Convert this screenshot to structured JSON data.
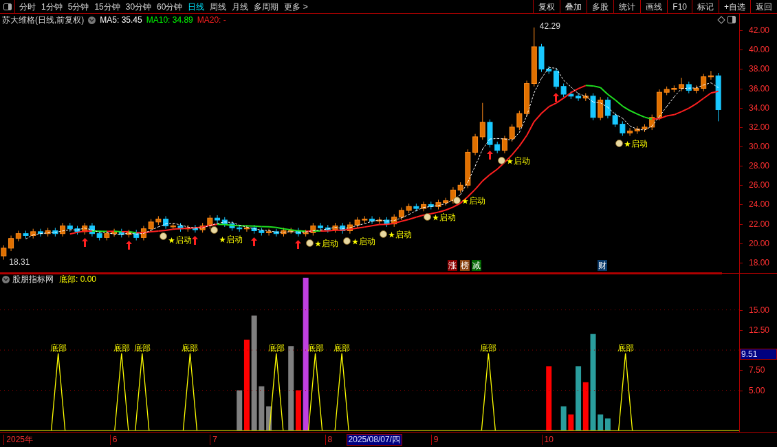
{
  "toolbar": {
    "tabs": [
      {
        "label": "分时",
        "selected": false
      },
      {
        "label": "1分钟",
        "selected": false
      },
      {
        "label": "5分钟",
        "selected": false
      },
      {
        "label": "15分钟",
        "selected": false
      },
      {
        "label": "30分钟",
        "selected": false
      },
      {
        "label": "60分钟",
        "selected": false
      },
      {
        "label": "日线",
        "selected": true
      },
      {
        "label": "周线",
        "selected": false
      },
      {
        "label": "月线",
        "selected": false
      },
      {
        "label": "多周期",
        "selected": false
      },
      {
        "label": "更多 >",
        "selected": false
      }
    ],
    "buttons": [
      "复权",
      "叠加",
      "多股",
      "统计",
      "画线",
      "F10",
      "标记",
      "+自选",
      "返回"
    ]
  },
  "main_panel": {
    "title": "苏大维格(日线,前复权)",
    "legend": [
      {
        "label": "MA5: 35.45",
        "color": "#ffffff"
      },
      {
        "label": "MA10: 34.89",
        "color": "#00ff00"
      },
      {
        "label": "MA20: -",
        "color": "#ff2020"
      }
    ],
    "chart_data": {
      "type": "candlestick",
      "ylim": [
        16.93,
        43.71
      ],
      "yticks": [
        {
          "value": 18,
          "label": "18.00"
        },
        {
          "value": 20,
          "label": "20.00"
        },
        {
          "value": 22,
          "label": "22.00"
        },
        {
          "value": 24,
          "label": "24.00"
        },
        {
          "value": 26,
          "label": "26.00"
        },
        {
          "value": 28,
          "label": "28.00"
        },
        {
          "value": 30,
          "label": "30.00"
        },
        {
          "value": 32,
          "label": "32.00"
        },
        {
          "value": 34,
          "label": "34.00"
        },
        {
          "value": 36,
          "label": "36.00"
        },
        {
          "value": 38,
          "label": "38.00"
        },
        {
          "value": 40,
          "label": "40.00"
        },
        {
          "value": 42,
          "label": "42.00"
        }
      ],
      "series": [
        {
          "ohlc": [
            [
              18.7,
              19.8,
              18.31,
              19.5
            ],
            [
              19.5,
              20.8,
              19.2,
              20.5
            ],
            [
              20.5,
              21.3,
              20.2,
              21
            ],
            [
              21,
              21.3,
              20.5,
              20.8
            ],
            [
              20.8,
              21.5,
              20.5,
              21.2
            ],
            [
              21.2,
              21.5,
              20.7,
              21
            ],
            [
              21,
              21.6,
              20.7,
              21.3
            ],
            [
              21.3,
              21.6,
              20.7,
              21
            ],
            [
              21,
              22.1,
              20.7,
              21.8
            ],
            [
              21.8,
              22.1,
              21.2,
              21.5
            ],
            [
              21.5,
              21.8,
              20.9,
              21.2
            ],
            [
              21.2,
              22.1,
              20.9,
              21.8
            ],
            [
              21.8,
              22.1,
              20.7,
              21
            ],
            [
              21,
              21.3,
              20.3,
              20.6
            ],
            [
              20.6,
              21.3,
              20.3,
              21
            ],
            [
              21,
              21.5,
              20.7,
              21.2
            ],
            [
              21.2,
              21.5,
              20.6,
              20.9
            ],
            [
              20.9,
              21.4,
              20.6,
              21.1
            ],
            [
              21.1,
              21.4,
              20.3,
              20.6
            ],
            [
              20.6,
              21.8,
              20.3,
              21.5
            ],
            [
              21.5,
              22.5,
              21.2,
              22.2
            ],
            [
              22.2,
              22.8,
              21.9,
              22.5
            ],
            [
              22.5,
              22.8,
              21.5,
              21.8
            ],
            [
              21.8,
              22.1,
              21.5,
              21.8
            ],
            [
              21.8,
              22.1,
              21.2,
              21.5
            ],
            [
              21.5,
              21.9,
              21.2,
              21.6
            ],
            [
              21.6,
              21.9,
              21.1,
              21.4
            ],
            [
              21.4,
              22.1,
              21.1,
              21.8
            ],
            [
              21.8,
              22.9,
              21.5,
              22.6
            ],
            [
              22.6,
              22.9,
              22.1,
              22.4
            ],
            [
              22.4,
              22.7,
              21.7,
              22
            ],
            [
              22,
              22.3,
              21.3,
              21.6
            ],
            [
              21.6,
              21.9,
              21.2,
              21.5
            ],
            [
              21.5,
              21.9,
              21.2,
              21.6
            ],
            [
              21.6,
              21.9,
              21,
              21.3
            ],
            [
              21.3,
              21.6,
              20.8,
              21.1
            ],
            [
              21.1,
              21.5,
              20.8,
              21.2
            ],
            [
              21.2,
              21.5,
              20.7,
              21
            ],
            [
              21,
              21.6,
              20.7,
              21.3
            ],
            [
              21.3,
              21.6,
              21,
              21.3
            ],
            [
              21.3,
              21.6,
              20.7,
              21
            ],
            [
              21,
              21.4,
              20.7,
              21.1
            ],
            [
              21.1,
              22.1,
              20.8,
              21.8
            ],
            [
              21.8,
              22.1,
              21.3,
              21.6
            ],
            [
              21.6,
              21.9,
              21.1,
              21.4
            ],
            [
              21.4,
              22.1,
              21.1,
              21.8
            ],
            [
              21.8,
              22.1,
              21,
              21.3
            ],
            [
              21.3,
              22.2,
              21,
              21.9
            ],
            [
              21.9,
              22.7,
              21.6,
              22.4
            ],
            [
              22.4,
              22.8,
              22.1,
              22.5
            ],
            [
              22.5,
              22.8,
              22,
              22.3
            ],
            [
              22.3,
              22.7,
              22,
              22.4
            ],
            [
              22.4,
              22.7,
              21.7,
              22
            ],
            [
              22,
              23,
              21.7,
              22.7
            ],
            [
              22.7,
              23.7,
              22.4,
              23.4
            ],
            [
              23.4,
              24.1,
              23.1,
              23.8
            ],
            [
              23.8,
              24.1,
              23.3,
              23.6
            ],
            [
              23.6,
              24.3,
              23.3,
              24
            ],
            [
              24,
              24.3,
              23.5,
              23.8
            ],
            [
              23.8,
              24.5,
              23.5,
              24.2
            ],
            [
              24.2,
              24.7,
              23.9,
              24.4
            ],
            [
              24.4,
              25.8,
              24.1,
              25.5
            ],
            [
              25.5,
              26.3,
              25.2,
              26
            ],
            [
              26,
              29.7,
              25.7,
              29.4
            ],
            [
              29.4,
              31.3,
              29.1,
              31
            ],
            [
              31,
              34.5,
              30.7,
              32.5
            ],
            [
              32.5,
              32.8,
              29.9,
              30.2
            ],
            [
              30.2,
              30.5,
              29.3,
              29.6
            ],
            [
              29.6,
              31.1,
              29.3,
              30.8
            ],
            [
              30.8,
              32.3,
              30.5,
              32
            ],
            [
              32,
              33.7,
              31.7,
              33.4
            ],
            [
              33.4,
              36.8,
              33.1,
              36.5
            ],
            [
              36.5,
              42.29,
              36.2,
              40.3
            ],
            [
              40.3,
              40.6,
              37.7,
              38
            ],
            [
              38,
              38.3,
              37.5,
              37.8
            ],
            [
              37.8,
              38.1,
              35.9,
              36.2
            ],
            [
              36.2,
              36.5,
              35.1,
              35.4
            ],
            [
              35.4,
              35.7,
              34.9,
              35.2
            ],
            [
              35.2,
              35.5,
              34.7,
              35
            ],
            [
              35,
              35.5,
              34.7,
              35.2
            ],
            [
              35.2,
              35.5,
              32.7,
              33
            ],
            [
              33,
              35.1,
              32.7,
              34.8
            ],
            [
              34.8,
              35.1,
              32.9,
              33.2
            ],
            [
              33.2,
              33.5,
              32,
              32.3
            ],
            [
              32.3,
              32.6,
              31.1,
              31.4
            ],
            [
              31.4,
              31.9,
              31.1,
              31.6
            ],
            [
              31.6,
              32.1,
              31.3,
              31.8
            ],
            [
              31.8,
              32.3,
              31.5,
              32
            ],
            [
              32,
              33.3,
              31.7,
              33
            ],
            [
              33,
              35.9,
              32.7,
              35.6
            ],
            [
              35.6,
              36.2,
              35.3,
              35.9
            ],
            [
              35.9,
              36.3,
              35.6,
              36
            ],
            [
              36,
              37.1,
              35.7,
              36.4
            ],
            [
              36.4,
              36.7,
              35.5,
              35.8
            ],
            [
              35.8,
              36.3,
              35.5,
              36
            ],
            [
              36,
              37.5,
              35.7,
              37.2
            ],
            [
              37.2,
              37.8,
              36.9,
              37.3
            ],
            [
              37.3,
              37.6,
              32.6,
              33.8
            ]
          ]
        }
      ],
      "annotations": [
        "18.31",
        "42.29"
      ]
    },
    "markers": [
      {
        "kind": "start",
        "text": "启动"
      },
      {
        "kind": "start",
        "text": "启动"
      },
      {
        "kind": "start",
        "text": "启动"
      },
      {
        "kind": "start",
        "text": "启动"
      },
      {
        "kind": "start",
        "text": "启动"
      },
      {
        "kind": "start",
        "text": "启动"
      },
      {
        "kind": "start",
        "text": "启动"
      },
      {
        "kind": "start",
        "text": "启动"
      },
      {
        "kind": "start",
        "text": "启动"
      },
      {
        "kind": "arrow"
      },
      {
        "kind": "arrow"
      },
      {
        "kind": "arrow"
      },
      {
        "kind": "arrow"
      },
      {
        "kind": "arrow"
      },
      {
        "kind": "arrow"
      },
      {
        "kind": "arrow"
      }
    ],
    "badges": [
      {
        "text": "涨",
        "color": "#8b0000"
      },
      {
        "text": "榜",
        "color": "#8b4513"
      },
      {
        "text": "减",
        "color": "#006400"
      },
      {
        "text": "财",
        "color": "#0a3a6a"
      }
    ]
  },
  "lower_panel": {
    "title": "股朋指标网",
    "reading": "底部: 0.00",
    "current_value": "9.51",
    "chart_data": {
      "type": "bar",
      "ylim": [
        0,
        19.5
      ],
      "yticks": [
        {
          "value": 5,
          "label": "5.00"
        },
        {
          "value": 7.5,
          "label": "7.50"
        },
        {
          "value": 12.5,
          "label": "12.50"
        },
        {
          "value": 15,
          "label": "15.00"
        }
      ],
      "series": [
        {
          "color": "#ff0000",
          "values": [
            null,
            null,
            null,
            null,
            null,
            null,
            null,
            null,
            null,
            null,
            null,
            null,
            null,
            null,
            null,
            null,
            null,
            null,
            null,
            null,
            null,
            null,
            null,
            null,
            null,
            null,
            null,
            null,
            null,
            null,
            null,
            null,
            null,
            11.3,
            null,
            null,
            null,
            null,
            null,
            null,
            5,
            null,
            null,
            null,
            null,
            null,
            null,
            null,
            null,
            null,
            null,
            null,
            null,
            null,
            null,
            null,
            null,
            null,
            null,
            null,
            null,
            null,
            null,
            null,
            null,
            null,
            null,
            null,
            null,
            null,
            null,
            null,
            null,
            null,
            8,
            null,
            null,
            2,
            null,
            6,
            null,
            null,
            null,
            null,
            null,
            null,
            null,
            null,
            null,
            null,
            null,
            null,
            null,
            null,
            null,
            null,
            null,
            null
          ]
        },
        {
          "color": "#808080",
          "values": [
            null,
            null,
            null,
            null,
            null,
            null,
            null,
            null,
            null,
            null,
            null,
            null,
            null,
            null,
            null,
            null,
            null,
            null,
            null,
            null,
            null,
            null,
            null,
            null,
            null,
            null,
            null,
            null,
            null,
            null,
            null,
            null,
            5,
            null,
            14.3,
            5.5,
            3,
            null,
            null,
            10.5,
            null,
            null,
            null,
            null,
            null,
            null,
            null,
            null,
            null,
            null,
            null,
            null,
            null,
            null,
            null,
            null,
            null,
            null,
            null,
            null,
            null,
            null,
            null,
            null,
            null,
            null,
            null,
            null,
            null,
            null,
            null,
            null,
            null,
            null,
            null,
            null,
            null,
            null,
            null,
            null,
            null,
            null,
            null,
            null,
            null,
            null,
            null,
            null,
            null,
            null,
            null,
            null,
            null,
            null,
            null,
            null,
            null,
            null
          ]
        },
        {
          "color": "#2a9d9d",
          "values": [
            null,
            null,
            null,
            null,
            null,
            null,
            null,
            null,
            null,
            null,
            null,
            null,
            null,
            null,
            null,
            null,
            null,
            null,
            null,
            null,
            null,
            null,
            null,
            null,
            null,
            null,
            null,
            null,
            null,
            null,
            null,
            null,
            null,
            null,
            null,
            null,
            null,
            null,
            null,
            null,
            null,
            null,
            null,
            null,
            null,
            null,
            null,
            null,
            null,
            null,
            null,
            null,
            null,
            null,
            null,
            null,
            null,
            null,
            null,
            null,
            null,
            null,
            null,
            null,
            null,
            null,
            null,
            null,
            null,
            null,
            null,
            null,
            null,
            null,
            null,
            null,
            3,
            null,
            8,
            null,
            12,
            2,
            1.5,
            null,
            null,
            null,
            null,
            null,
            null,
            null,
            null,
            null,
            null,
            null,
            null,
            null,
            null,
            null
          ]
        },
        {
          "color": "#c040e0",
          "values": [
            null,
            null,
            null,
            null,
            null,
            null,
            null,
            null,
            null,
            null,
            null,
            null,
            null,
            null,
            null,
            null,
            null,
            null,
            null,
            null,
            null,
            null,
            null,
            null,
            null,
            null,
            null,
            null,
            null,
            null,
            null,
            null,
            null,
            null,
            null,
            null,
            null,
            null,
            null,
            null,
            null,
            19,
            null,
            null,
            null,
            null,
            null,
            null,
            null,
            null,
            null,
            null,
            null,
            null,
            null,
            null,
            null,
            null,
            null,
            null,
            null,
            null,
            null,
            null,
            null,
            null,
            null,
            null,
            null,
            null,
            null,
            null,
            null,
            null,
            null,
            null,
            null,
            null,
            null,
            null,
            null,
            null,
            null,
            null,
            null,
            null,
            null,
            null,
            null,
            null,
            null,
            null,
            null,
            null,
            null,
            null,
            null,
            null
          ]
        }
      ]
    },
    "signals": [
      "底部",
      "底部",
      "底部",
      "底部",
      "底部",
      "底部",
      "底部",
      "底部",
      "底部"
    ]
  },
  "time_axis": {
    "labels": [
      "2025年",
      "6",
      "7",
      "8",
      "9",
      "10"
    ],
    "cursor": "2025/08/07/四"
  }
}
